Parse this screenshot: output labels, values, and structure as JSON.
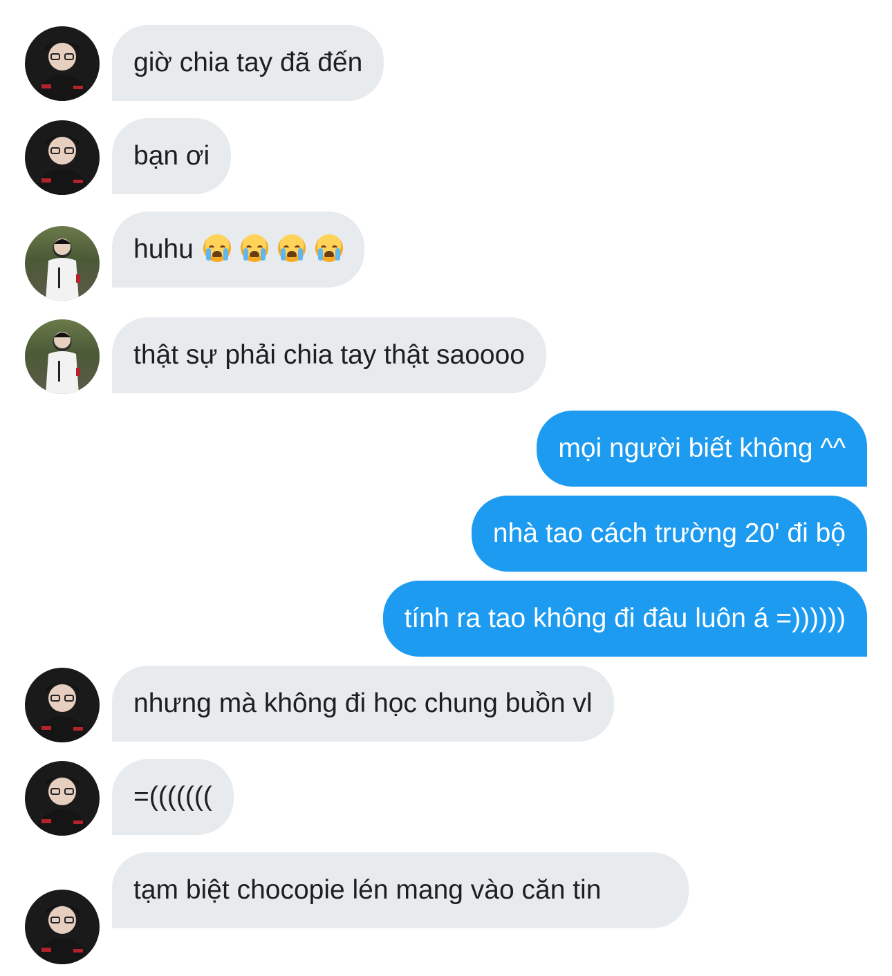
{
  "conversation": {
    "messages": [
      {
        "direction": "in",
        "avatar": "dark",
        "text": "giờ chia tay đã đến"
      },
      {
        "direction": "in",
        "avatar": "dark",
        "text": "bạn ơi"
      },
      {
        "direction": "in",
        "avatar": "white-jacket",
        "text": "huhu",
        "emoji": [
          "loudly-crying-face-emoji",
          "loudly-crying-face-emoji",
          "loudly-crying-face-emoji",
          "loudly-crying-face-emoji"
        ]
      },
      {
        "direction": "in",
        "avatar": "white-jacket",
        "text": "thật sự phải chia tay thật saoooo"
      },
      {
        "direction": "out",
        "text": "mọi người biết không ^^"
      },
      {
        "direction": "out",
        "text": "nhà tao cách trường 20' đi bộ"
      },
      {
        "direction": "out",
        "text": "tính ra tao không đi đâu luôn á =))))))"
      },
      {
        "direction": "in",
        "avatar": "dark",
        "text": "nhưng mà không đi học chung buồn vl"
      },
      {
        "direction": "in",
        "avatar": "dark",
        "text": "=((((((("
      },
      {
        "direction": "in",
        "avatar": "dark",
        "text": "tạm biệt chocopie lén mang vào căn tin"
      }
    ]
  },
  "colors": {
    "incoming_bubble": "#e8ebee",
    "outgoing_bubble": "#1d9bf0",
    "incoming_text": "#1c1e21",
    "outgoing_text": "#ffffff"
  }
}
